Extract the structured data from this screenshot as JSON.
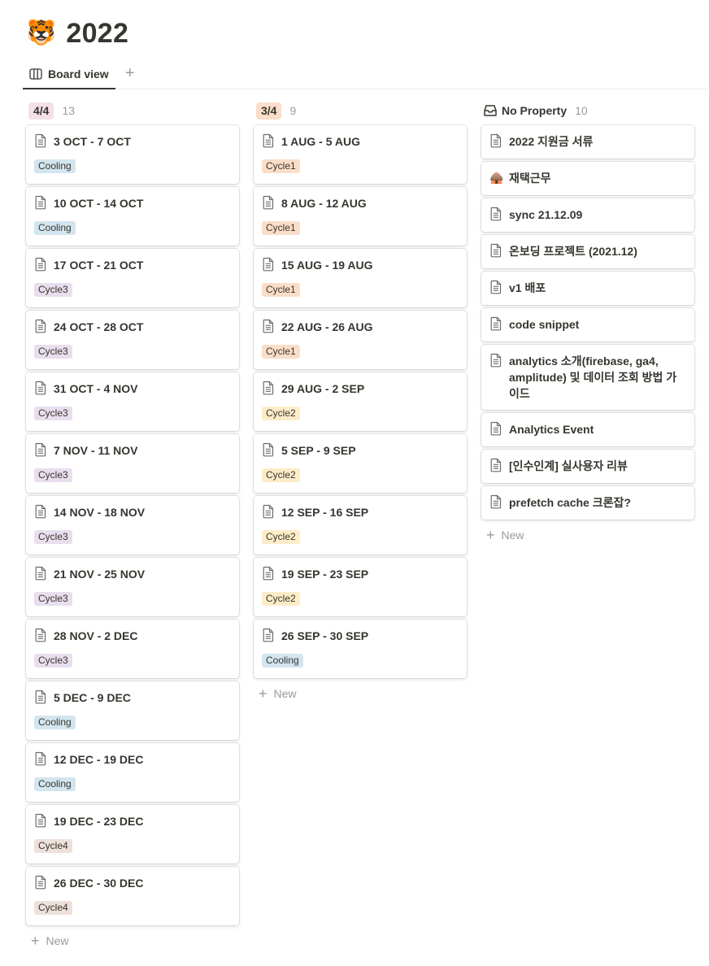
{
  "page": {
    "emoji": "🐯",
    "title": "2022"
  },
  "views": {
    "tabs": [
      {
        "label": "Board view",
        "icon": "board-view-icon"
      }
    ],
    "add_label": "+"
  },
  "colors": {
    "cooling": "#d3e5ef",
    "cycle1": "#fadec9",
    "cycle2": "#fdecc8",
    "cycle3": "#e8deee",
    "cycle4": "#eee0da",
    "badge_44": "#f5e0e9",
    "badge_34": "#fadec9"
  },
  "columns": [
    {
      "badge": "4/4",
      "badge_color": "#f5e0e9",
      "count": "13",
      "cards": [
        {
          "title": "3 OCT - 7 OCT",
          "tag": "Cooling",
          "tag_color": "#d3e5ef"
        },
        {
          "title": "10 OCT - 14 OCT",
          "tag": "Cooling",
          "tag_color": "#d3e5ef"
        },
        {
          "title": "17 OCT - 21 OCT",
          "tag": "Cycle3",
          "tag_color": "#e8deee"
        },
        {
          "title": "24 OCT - 28 OCT",
          "tag": "Cycle3",
          "tag_color": "#e8deee"
        },
        {
          "title": "31 OCT - 4 NOV",
          "tag": "Cycle3",
          "tag_color": "#e8deee"
        },
        {
          "title": "7 NOV - 11 NOV",
          "tag": "Cycle3",
          "tag_color": "#e8deee"
        },
        {
          "title": "14 NOV - 18 NOV",
          "tag": "Cycle3",
          "tag_color": "#e8deee"
        },
        {
          "title": "21 NOV - 25 NOV",
          "tag": "Cycle3",
          "tag_color": "#e8deee"
        },
        {
          "title": "28 NOV - 2 DEC",
          "tag": "Cycle3",
          "tag_color": "#e8deee"
        },
        {
          "title": "5 DEC - 9 DEC",
          "tag": "Cooling",
          "tag_color": "#d3e5ef"
        },
        {
          "title": "12 DEC - 19 DEC",
          "tag": "Cooling",
          "tag_color": "#d3e5ef"
        },
        {
          "title": "19 DEC - 23 DEC",
          "tag": "Cycle4",
          "tag_color": "#eee0da"
        },
        {
          "title": "26 DEC - 30 DEC",
          "tag": "Cycle4",
          "tag_color": "#eee0da"
        }
      ],
      "new_label": "New"
    },
    {
      "badge": "3/4",
      "badge_color": "#fadec9",
      "count": "9",
      "cards": [
        {
          "title": "1 AUG - 5 AUG",
          "tag": "Cycle1",
          "tag_color": "#fadec9"
        },
        {
          "title": "8 AUG - 12 AUG",
          "tag": "Cycle1",
          "tag_color": "#fadec9"
        },
        {
          "title": "15 AUG - 19 AUG",
          "tag": "Cycle1",
          "tag_color": "#fadec9"
        },
        {
          "title": "22 AUG - 26 AUG",
          "tag": "Cycle1",
          "tag_color": "#fadec9"
        },
        {
          "title": "29 AUG - 2 SEP",
          "tag": "Cycle2",
          "tag_color": "#fdecc8"
        },
        {
          "title": "5 SEP - 9 SEP",
          "tag": "Cycle2",
          "tag_color": "#fdecc8"
        },
        {
          "title": "12 SEP - 16 SEP",
          "tag": "Cycle2",
          "tag_color": "#fdecc8"
        },
        {
          "title": "19 SEP - 23 SEP",
          "tag": "Cycle2",
          "tag_color": "#fdecc8"
        },
        {
          "title": "26 SEP - 30 SEP",
          "tag": "Cooling",
          "tag_color": "#d3e5ef"
        }
      ],
      "new_label": "New"
    },
    {
      "title": "No Property",
      "icon": "inbox-icon",
      "count": "10",
      "cards": [
        {
          "title": "2022 지원금 서류",
          "icon": "doc"
        },
        {
          "title": "재택근무",
          "icon": "emoji",
          "emoji": "🛖"
        },
        {
          "title": "sync 21.12.09",
          "icon": "doc"
        },
        {
          "title": "온보딩 프로젝트 (2021.12)",
          "icon": "doc"
        },
        {
          "title": "v1 배포",
          "icon": "doc"
        },
        {
          "title": "code snippet",
          "icon": "doc"
        },
        {
          "title": "analytics 소개(firebase, ga4, amplitude) 및 데이터 조회 방법 가이드",
          "icon": "doc"
        },
        {
          "title": "Analytics Event",
          "icon": "doc"
        },
        {
          "title": "[인수인계] 실사용자 리뷰",
          "icon": "doc"
        },
        {
          "title": "prefetch cache 크론잡?",
          "icon": "doc"
        }
      ],
      "new_label": "New"
    }
  ]
}
